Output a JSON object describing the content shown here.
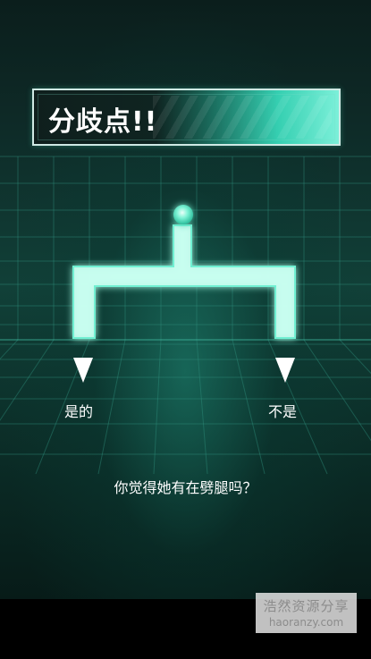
{
  "banner": {
    "title": "分歧点!!"
  },
  "branch": {
    "left_label": "是的",
    "right_label": "不是"
  },
  "question": "你觉得她有在劈腿吗？",
  "watermark": {
    "line1": "浩然资源分享",
    "line2": "haoranzy.com"
  },
  "colors": {
    "accent": "#3fe0c0",
    "glow": "#bffff0",
    "background": "#0e2a27"
  }
}
